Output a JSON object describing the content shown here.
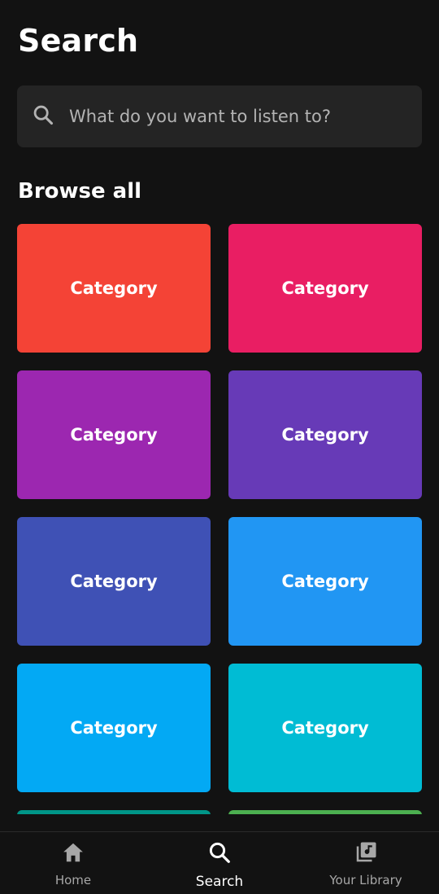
{
  "page": {
    "title": "Search"
  },
  "search": {
    "placeholder": "What do you want to listen to?",
    "icon": "search-icon"
  },
  "browse": {
    "heading": "Browse all",
    "tiles": [
      {
        "label": "Category",
        "color": "#F44336"
      },
      {
        "label": "Category",
        "color": "#E91E63"
      },
      {
        "label": "Category",
        "color": "#9C27B0"
      },
      {
        "label": "Category",
        "color": "#673AB7"
      },
      {
        "label": "Category",
        "color": "#3F51B5"
      },
      {
        "label": "Category",
        "color": "#2196F3"
      },
      {
        "label": "Category",
        "color": "#03A9F4"
      },
      {
        "label": "Category",
        "color": "#00BCD4"
      }
    ],
    "partial_tiles": [
      {
        "color": "#009688"
      },
      {
        "color": "#4CAF50"
      }
    ]
  },
  "bottom_nav": {
    "items": [
      {
        "label": "Home",
        "icon": "home-icon",
        "active": false
      },
      {
        "label": "Search",
        "icon": "search-icon",
        "active": true
      },
      {
        "label": "Your Library",
        "icon": "library-icon",
        "active": false
      }
    ]
  },
  "colors": {
    "background": "#121212",
    "search_bar": "#242424",
    "inactive_text": "#a7a7a7"
  }
}
